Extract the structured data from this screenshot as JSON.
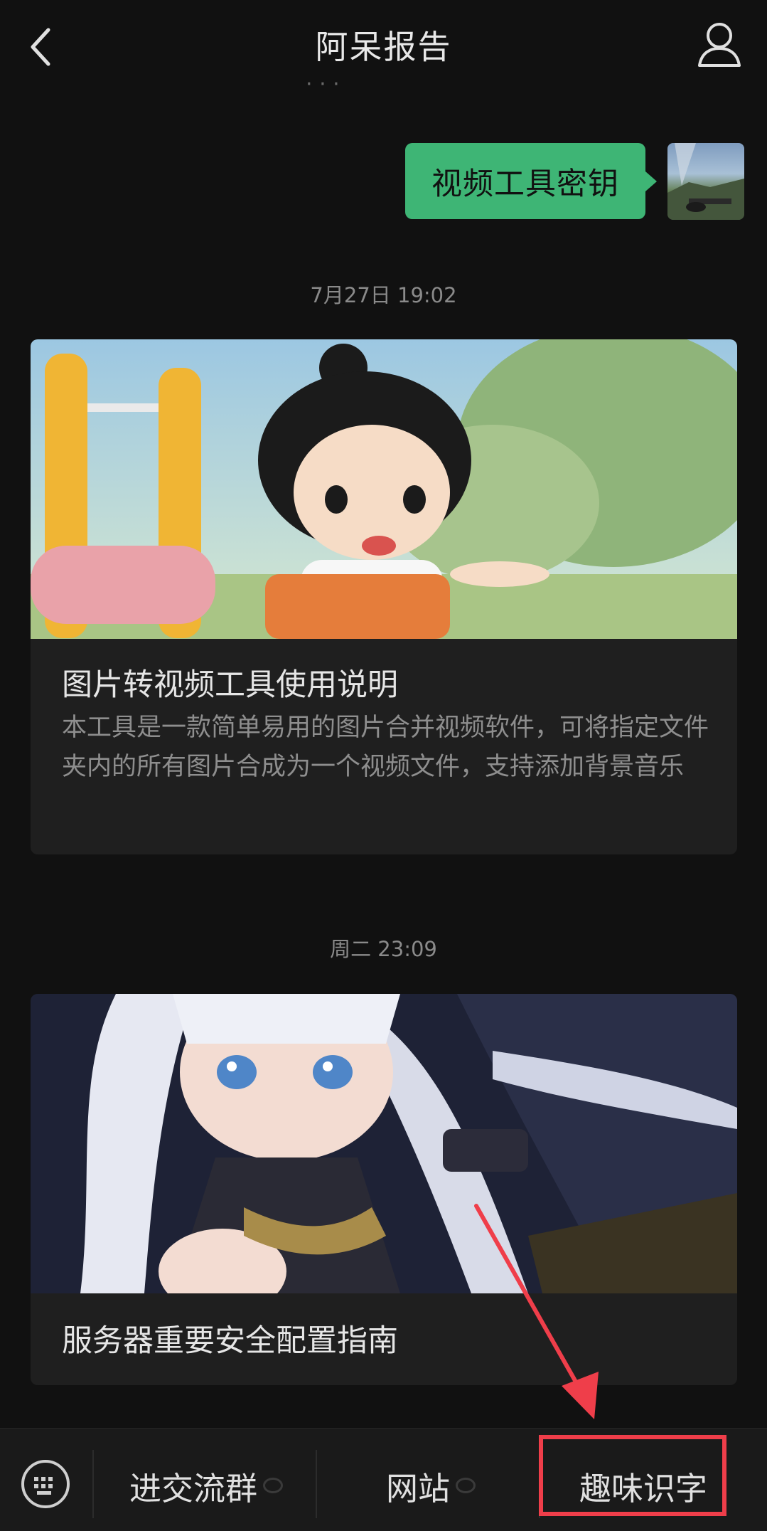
{
  "header": {
    "title": "阿呆报告",
    "back_icon": "chevron-left-icon",
    "profile_icon": "person-icon"
  },
  "messages": [
    {
      "text": "视频工具密钥",
      "bubble_color": "#3eb575"
    }
  ],
  "articles": [
    {
      "timestamp": "7月27日 19:02",
      "title": "图片转视频工具使用说明",
      "description": "本工具是一款简单易用的图片合并视频软件，可将指定文件夹内的所有图片合成为一个视频文件，支持添加背景音乐"
    },
    {
      "timestamp": "周二 23:09",
      "title": "服务器重要安全配置指南"
    }
  ],
  "bottom_menu": {
    "keyboard_icon": "keyboard-icon",
    "items": [
      {
        "label": "进交流群"
      },
      {
        "label": "网站"
      },
      {
        "label": "趣味识字"
      }
    ]
  },
  "annotation": {
    "color": "#ef3e4a",
    "highlighted_item": "趣味识字"
  }
}
